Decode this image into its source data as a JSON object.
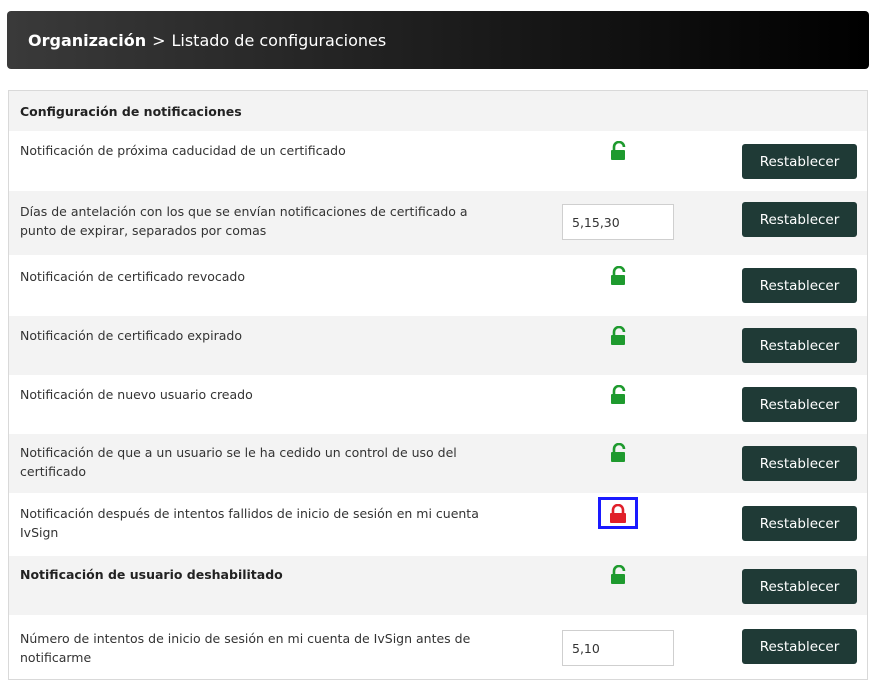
{
  "breadcrumb": {
    "root": "Organización",
    "separator": ">",
    "current": "Listado de configuraciones"
  },
  "panel": {
    "title": "Configuración de notificaciones"
  },
  "rows": [
    {
      "label": "Notificación de próxima caducidad de un certificado",
      "control": "lock",
      "lock_state": "unlocked",
      "lock_color": "#1e9a2e",
      "button": "Restablecer"
    },
    {
      "label": "Días de antelación con los que se envían notificaciones de certificado a punto de expirar, separados por comas",
      "control": "input",
      "input_value": "5,15,30",
      "button": "Restablecer"
    },
    {
      "label": "Notificación de certificado revocado",
      "control": "lock",
      "lock_state": "unlocked",
      "lock_color": "#1e9a2e",
      "button": "Restablecer"
    },
    {
      "label": "Notificación de certificado expirado",
      "control": "lock",
      "lock_state": "unlocked",
      "lock_color": "#1e9a2e",
      "button": "Restablecer"
    },
    {
      "label": "Notificación de nuevo usuario creado",
      "control": "lock",
      "lock_state": "unlocked",
      "lock_color": "#1e9a2e",
      "button": "Restablecer"
    },
    {
      "label": "Notificación de que a un usuario se le ha cedido un control de uso del certificado",
      "control": "lock",
      "lock_state": "unlocked",
      "lock_color": "#1e9a2e",
      "button": "Restablecer"
    },
    {
      "label": "Notificación después de intentos fallidos de inicio de sesión en mi cuenta IvSign",
      "control": "lock",
      "lock_state": "locked",
      "lock_color": "#e0202a",
      "highlight_color": "#1a1aff",
      "button": "Restablecer"
    },
    {
      "label": "Notificación de usuario deshabilitado",
      "control": "lock",
      "lock_state": "unlocked",
      "lock_color": "#1e9a2e",
      "button": "Restablecer",
      "bold": true
    },
    {
      "label": "Número de intentos de inicio de sesión en mi cuenta de IvSign antes de notificarme",
      "control": "input",
      "input_value": "5,10",
      "button": "Restablecer"
    }
  ],
  "colors": {
    "button_bg": "#1f3a36",
    "header_bg": "#1a1a1a",
    "row_alt_bg": "#f3f3f3"
  }
}
